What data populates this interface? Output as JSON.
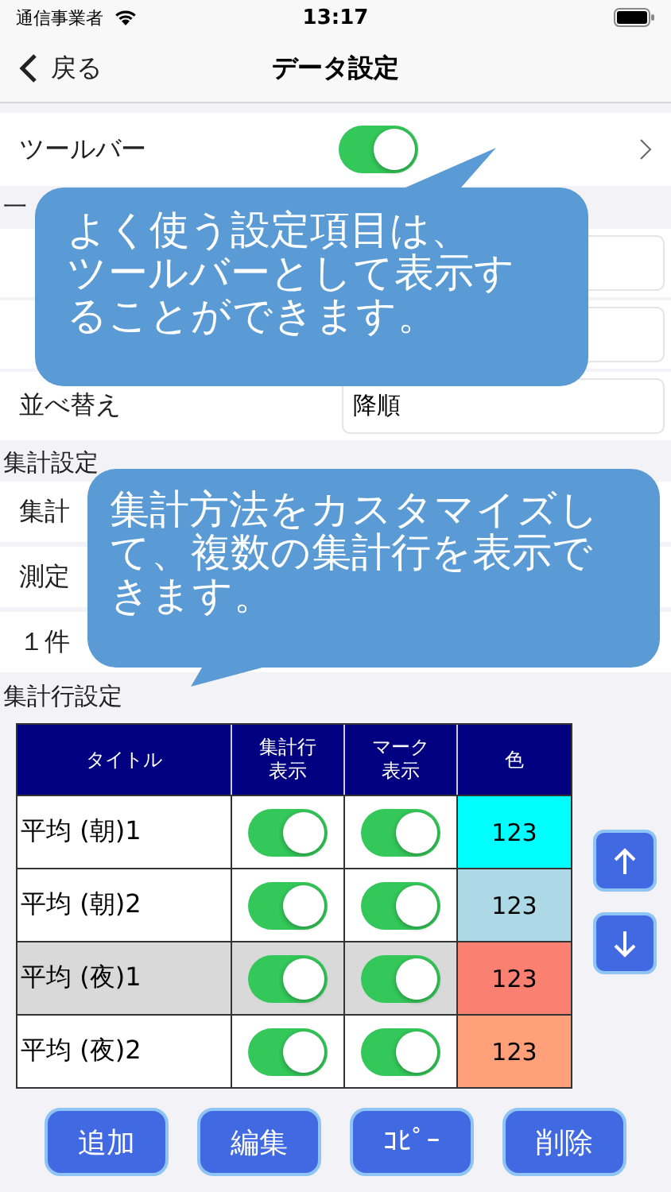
{
  "status_bar": {
    "carrier": "通信事業者",
    "time": "13:17"
  },
  "nav": {
    "back": "戻る",
    "title": "データ設定"
  },
  "toolbar_row": {
    "label": "ツールバー",
    "on": true
  },
  "sections": [
    {
      "title": "一",
      "rows": [
        {
          "kind": "field"
        },
        {
          "kind": "field"
        },
        {
          "kind": "field",
          "label": "並べ替え",
          "value": "降順"
        }
      ]
    },
    {
      "title": "集計設定",
      "rows": [
        {
          "kind": "plain",
          "label": "集計"
        },
        {
          "kind": "plain",
          "label": "測定"
        },
        {
          "kind": "plain",
          "label": "１件"
        }
      ]
    },
    {
      "title": "集計行設定"
    }
  ],
  "table": {
    "columns": [
      [
        "タイトル"
      ],
      [
        "集計行",
        "表示"
      ],
      [
        "マーク",
        "表示"
      ],
      [
        "色"
      ]
    ],
    "rows": [
      {
        "title": "平均 (朝)1",
        "row_on": true,
        "mark_on": true,
        "color_label": "123",
        "color": "#00ffff",
        "selected": false
      },
      {
        "title": "平均 (朝)2",
        "row_on": true,
        "mark_on": true,
        "color_label": "123",
        "color": "#add8e6",
        "selected": false
      },
      {
        "title": "平均 (夜)1",
        "row_on": true,
        "mark_on": true,
        "color_label": "123",
        "color": "#fa8072",
        "selected": true
      },
      {
        "title": "平均 (夜)2",
        "row_on": true,
        "mark_on": true,
        "color_label": "123",
        "color": "#ffa07a",
        "selected": false
      }
    ]
  },
  "buttons": [
    "追加",
    "編集",
    "ｺﾋﾟｰ",
    "削除"
  ],
  "callouts": [
    {
      "lines": [
        "よく使う設定項目は、",
        "ツールバーとして表示す",
        "ることができます。"
      ]
    },
    {
      "lines": [
        "集計方法をカスタマイズし",
        "て、複数の集計行を表示で",
        "きます。"
      ]
    }
  ]
}
